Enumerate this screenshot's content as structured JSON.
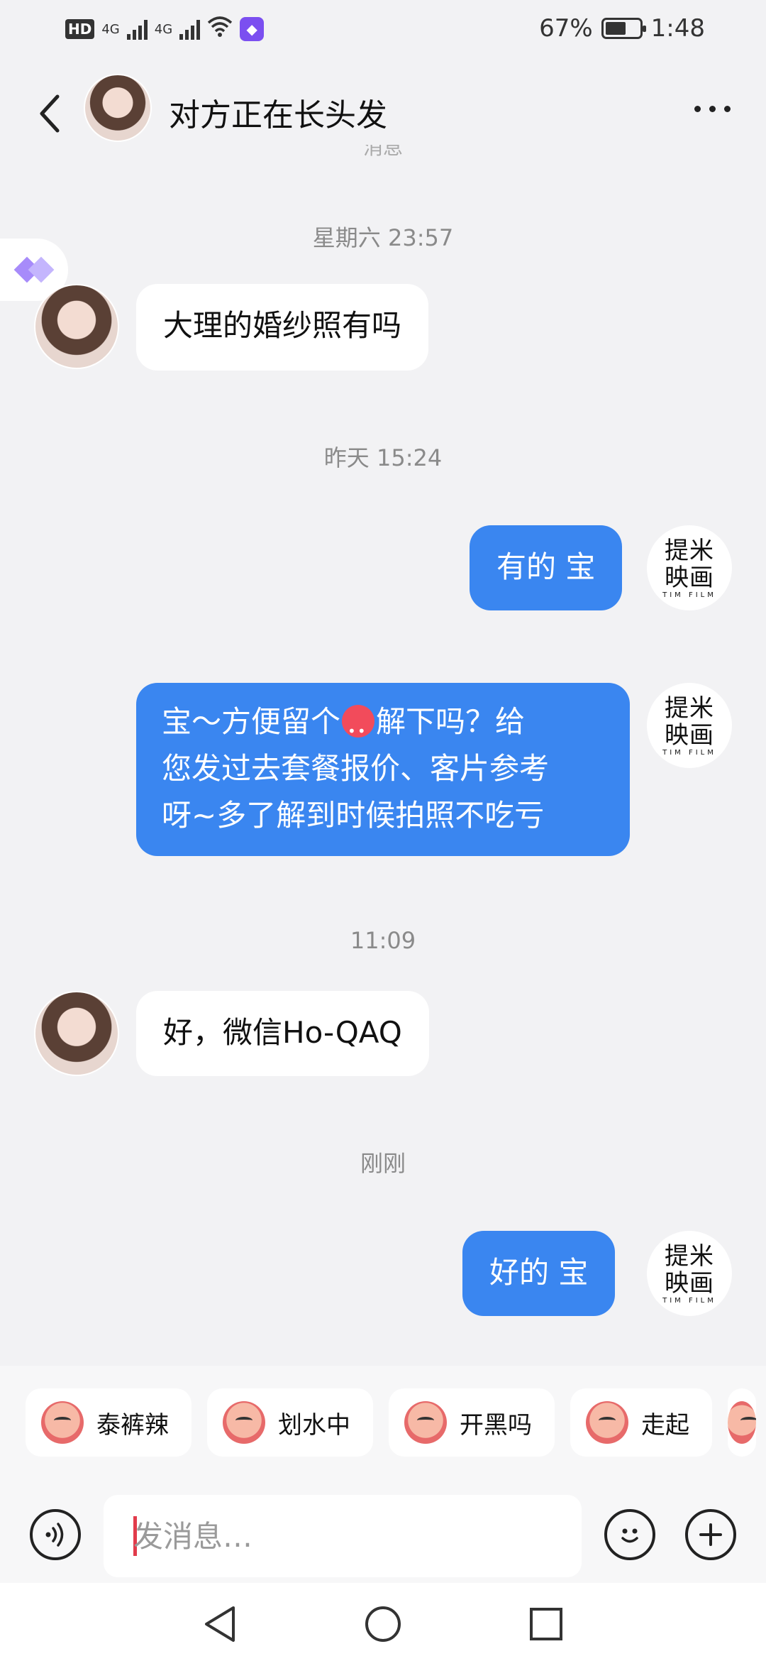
{
  "status_bar": {
    "network_badge": "HD",
    "sim1_type": "4G",
    "sim2_type": "4G",
    "battery_percent": "67%",
    "battery_level": 0.67,
    "time": "1:48"
  },
  "header": {
    "title": "对方正在长头发",
    "back_icon": "chevron-left-icon",
    "more_icon": "more-dots-icon"
  },
  "clipped_hint": "消息",
  "messages": [
    {
      "type": "time",
      "text": "星期六 23:57"
    },
    {
      "type": "in",
      "text": "大理的婚纱照有吗"
    },
    {
      "type": "time",
      "text": "昨天 15:24"
    },
    {
      "type": "out",
      "text": "有的 宝"
    },
    {
      "type": "out",
      "text_line1_a": "宝～方便留个",
      "text_line1_b": "解下吗？给",
      "text_line2": "您发过去套餐报价、客片参考",
      "text_line3": "呀~多了解到时候拍照不吃亏"
    },
    {
      "type": "time",
      "text": "11:09"
    },
    {
      "type": "in",
      "text": "好，微信Ho-QAQ"
    },
    {
      "type": "time",
      "text": "刚刚"
    },
    {
      "type": "out",
      "text": "好的 宝"
    }
  ],
  "brand_logo": {
    "line1": "提米",
    "line2": "映画",
    "sub": "TIM FILM"
  },
  "stickers": [
    {
      "label": "泰裤辣"
    },
    {
      "label": "划水中"
    },
    {
      "label": "开黑吗"
    },
    {
      "label": "走起"
    }
  ],
  "input": {
    "placeholder": "发消息…",
    "value": ""
  },
  "colors": {
    "outgoing_bubble": "#3a86f0",
    "background": "#f2f2f4",
    "accent_purple": "#7b4ff0"
  }
}
